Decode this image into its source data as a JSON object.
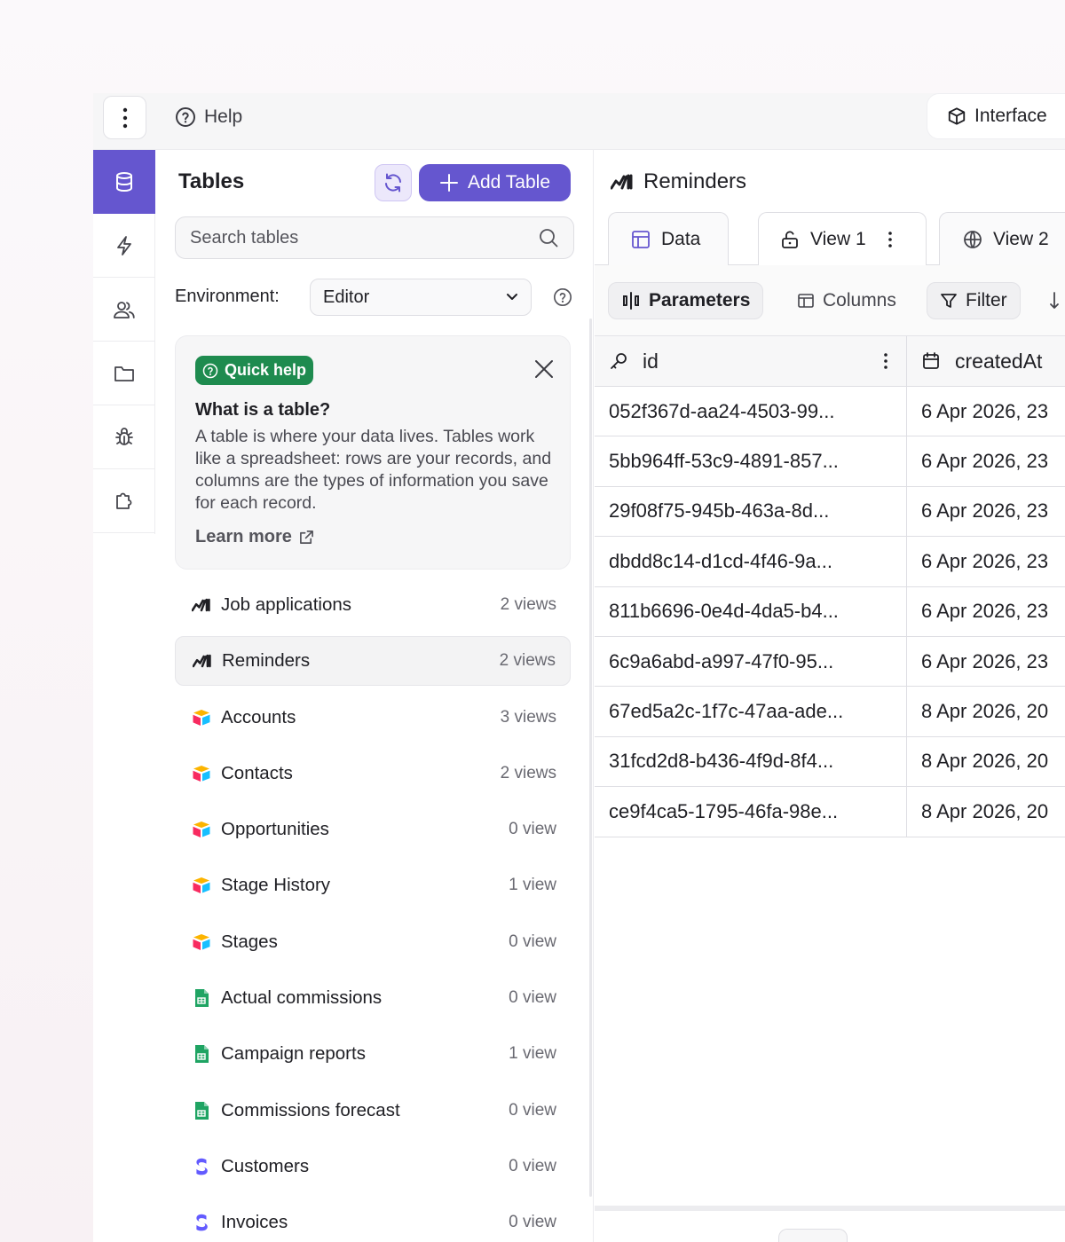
{
  "topbar": {
    "help_label": "Help",
    "interface_label": "Interface"
  },
  "rail": {
    "items": [
      {
        "icon": "database-icon",
        "active": true
      },
      {
        "icon": "lightning-icon",
        "active": false
      },
      {
        "icon": "users-icon",
        "active": false
      },
      {
        "icon": "folder-icon",
        "active": false
      },
      {
        "icon": "bug-icon",
        "active": false
      },
      {
        "icon": "puzzle-icon",
        "active": false
      }
    ]
  },
  "panel": {
    "title": "Tables",
    "add_label": "Add Table",
    "search_placeholder": "Search tables",
    "env_label": "Environment:",
    "env_value": "Editor",
    "quick": {
      "badge": "Quick help",
      "question": "What is a table?",
      "body": "A table is where your data lives. Tables work like a spreadsheet: rows are your records, and columns are the types of information you save for each record.",
      "learn_more": "Learn more"
    },
    "tables": [
      {
        "name": "Job applications",
        "count": "2 views",
        "icon": "native"
      },
      {
        "name": "Reminders",
        "count": "2 views",
        "icon": "native",
        "selected": true
      },
      {
        "name": "Accounts",
        "count": "3 views",
        "icon": "airtable"
      },
      {
        "name": "Contacts",
        "count": "2 views",
        "icon": "airtable"
      },
      {
        "name": "Opportunities",
        "count": "0 view",
        "icon": "airtable"
      },
      {
        "name": "Stage History",
        "count": "1 view",
        "icon": "airtable"
      },
      {
        "name": "Stages",
        "count": "0 view",
        "icon": "airtable"
      },
      {
        "name": "Actual commissions",
        "count": "0 view",
        "icon": "sheets"
      },
      {
        "name": "Campaign reports",
        "count": "1 view",
        "icon": "sheets"
      },
      {
        "name": "Commissions forecast",
        "count": "0 view",
        "icon": "sheets"
      },
      {
        "name": "Customers",
        "count": "0 view",
        "icon": "stripe"
      },
      {
        "name": "Invoices",
        "count": "0 view",
        "icon": "stripe"
      }
    ]
  },
  "content": {
    "title": "Reminders",
    "tabs": {
      "data": "Data",
      "view1": "View 1",
      "view2": "View 2"
    },
    "toolbar": {
      "parameters": "Parameters",
      "columns": "Columns",
      "filter": "Filter"
    },
    "columns": {
      "id": "id",
      "created": "createdAt"
    },
    "rows": [
      {
        "id": "052f367d-aa24-4503-99...",
        "created": "6 Apr 2026, 23"
      },
      {
        "id": "5bb964ff-53c9-4891-857...",
        "created": "6 Apr 2026, 23"
      },
      {
        "id": "29f08f75-945b-463a-8d...",
        "created": "6 Apr 2026, 23"
      },
      {
        "id": "dbdd8c14-d1cd-4f46-9a...",
        "created": "6 Apr 2026, 23"
      },
      {
        "id": "811b6696-0e4d-4da5-b4...",
        "created": "6 Apr 2026, 23"
      },
      {
        "id": "6c9a6abd-a997-47f0-95...",
        "created": "6 Apr 2026, 23"
      },
      {
        "id": "67ed5a2c-1f7c-47aa-ade...",
        "created": "8 Apr 2026, 20"
      },
      {
        "id": "31fcd2d8-b436-4f9d-8f4...",
        "created": "8 Apr 2026, 20"
      },
      {
        "id": "ce9f4ca5-1795-46fa-98e...",
        "created": "8 Apr 2026, 20"
      }
    ]
  },
  "colors": {
    "accent": "#6556cf",
    "quick_badge": "#1e8b4f"
  }
}
